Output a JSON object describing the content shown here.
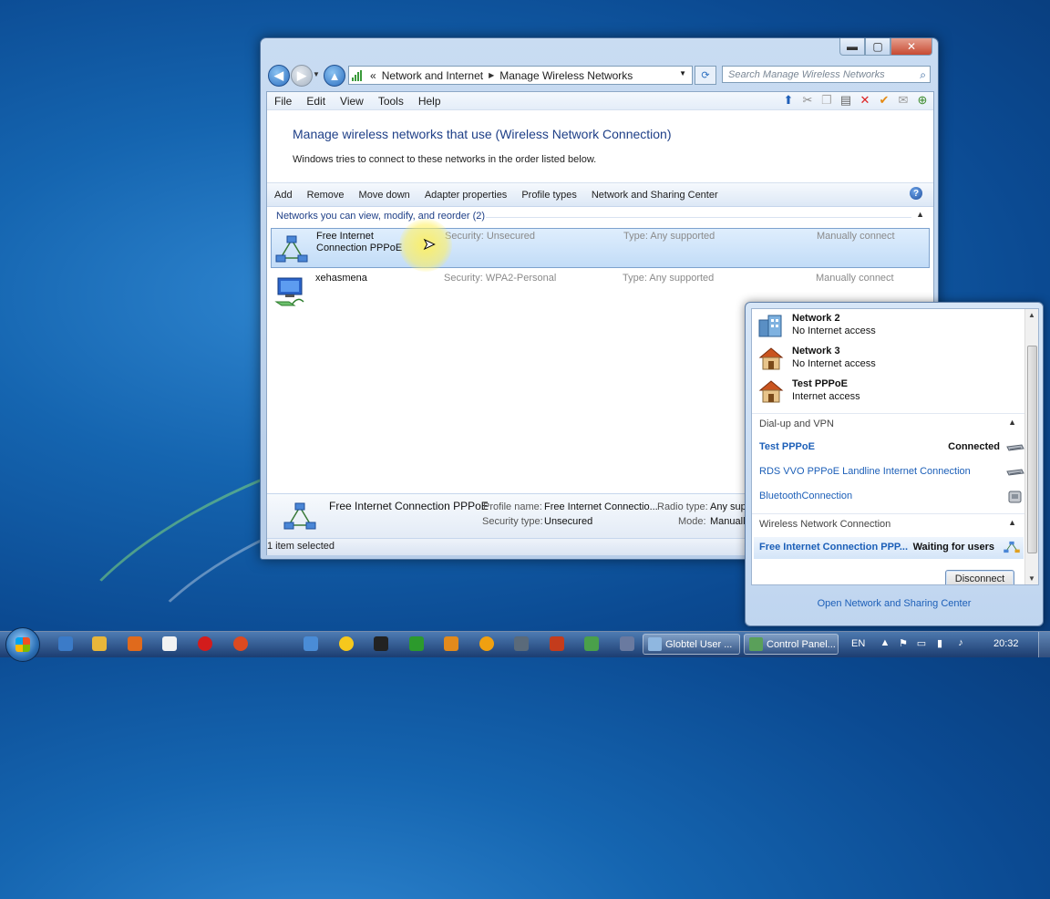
{
  "window": {
    "address": {
      "crumbs": [
        "Network and Internet",
        "Manage Wireless Networks"
      ],
      "leading_glyph": "«"
    },
    "search_placeholder": "Search Manage Wireless Networks",
    "menu": [
      "File",
      "Edit",
      "View",
      "Tools",
      "Help"
    ],
    "heading": "Manage wireless networks that use (Wireless Network Connection)",
    "subtext": "Windows tries to connect to these networks in the order listed below.",
    "commands": [
      "Add",
      "Remove",
      "Move down",
      "Adapter properties",
      "Profile types",
      "Network and Sharing Center"
    ],
    "group_header": "Networks you can view, modify, and reorder (2)",
    "networks": [
      {
        "name": "Free Internet Connection PPPoE",
        "security": "Security:  Unsecured",
        "type": "Type:  Any supported",
        "mode": "Manually connect",
        "selected": true
      },
      {
        "name": "xehasmena",
        "security": "Security:  WPA2-Personal",
        "type": "Type:  Any supported",
        "mode": "Manually connect",
        "selected": false
      }
    ],
    "details": {
      "title": "Free Internet Connection PPPoE",
      "profile_name_label": "Profile name:",
      "profile_name_value": "Free Internet Connectio...",
      "radio_type_label": "Radio type:",
      "radio_type_value": "Any sup",
      "security_type_label": "Security type:",
      "security_type_value": "Unsecured",
      "mode_label": "Mode:",
      "mode_value": "Manuall"
    },
    "status": "1 item selected"
  },
  "flyout": {
    "networks": [
      {
        "name": "Network  2",
        "status": "No Internet access",
        "icon": "network-building-icon"
      },
      {
        "name": "Network  3",
        "status": "No Internet access",
        "icon": "home-network-icon"
      },
      {
        "name": "Test PPPoE",
        "status": "Internet access",
        "icon": "home-network-icon"
      }
    ],
    "dialup_section": "Dial-up and VPN",
    "dialup": [
      {
        "name": "Test PPPoE",
        "status": "Connected"
      },
      {
        "name": "RDS VVO PPPoE Landline Internet Connection",
        "status": ""
      },
      {
        "name": "BluetoothConnection",
        "status": ""
      }
    ],
    "wireless_section": "Wireless Network Connection",
    "wireless": {
      "name": "Free Internet Connection PPP...",
      "status": "Waiting for users"
    },
    "disconnect_label": "Disconnect",
    "open_center_label": "Open Network and Sharing Center"
  },
  "taskbar": {
    "tasks": [
      "Globtel User ...",
      "Control Panel..."
    ],
    "language": "EN",
    "time": "20:32"
  },
  "colors": {
    "heading": "#1e3f87",
    "link": "#1c5fb8",
    "selection": "#c2dcf7"
  }
}
